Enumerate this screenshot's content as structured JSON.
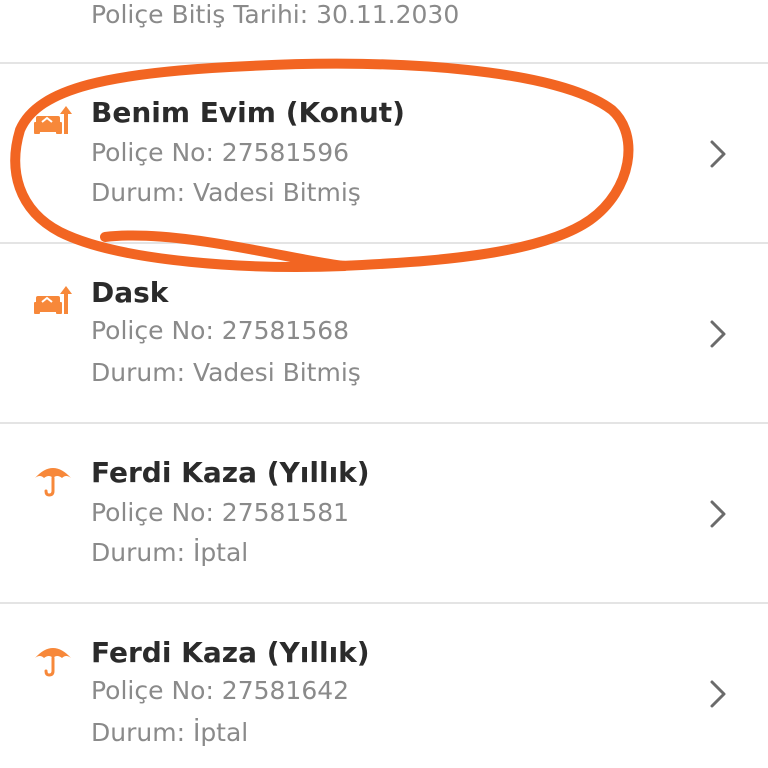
{
  "top_fragment": {
    "text": "Poliçe Bitiş Tarihi: 30.11.2030"
  },
  "policies": [
    {
      "title": "Benim Evim (Konut)",
      "policy_no": "Poliçe No: 27581596",
      "status": "Durum: Vadesi Bitmiş",
      "icon": "home-insurance-icon"
    },
    {
      "title": "Dask",
      "policy_no": "Poliçe No: 27581568",
      "status": "Durum: Vadesi Bitmiş",
      "icon": "home-insurance-icon"
    },
    {
      "title": "Ferdi Kaza (Yıllık)",
      "policy_no": "Poliçe No: 27581581",
      "status": "Durum: İptal",
      "icon": "umbrella-icon"
    },
    {
      "title": "Ferdi Kaza (Yıllık)",
      "policy_no": "Poliçe No: 27581642",
      "status": "Durum: İptal",
      "icon": "umbrella-icon"
    }
  ],
  "colors": {
    "accent": "#f7883a",
    "annotation": "#f26522",
    "title": "#2b2b2b",
    "secondary": "#8a8a8a",
    "divider": "#e4e4e4",
    "chevron": "#6b6b6b"
  }
}
